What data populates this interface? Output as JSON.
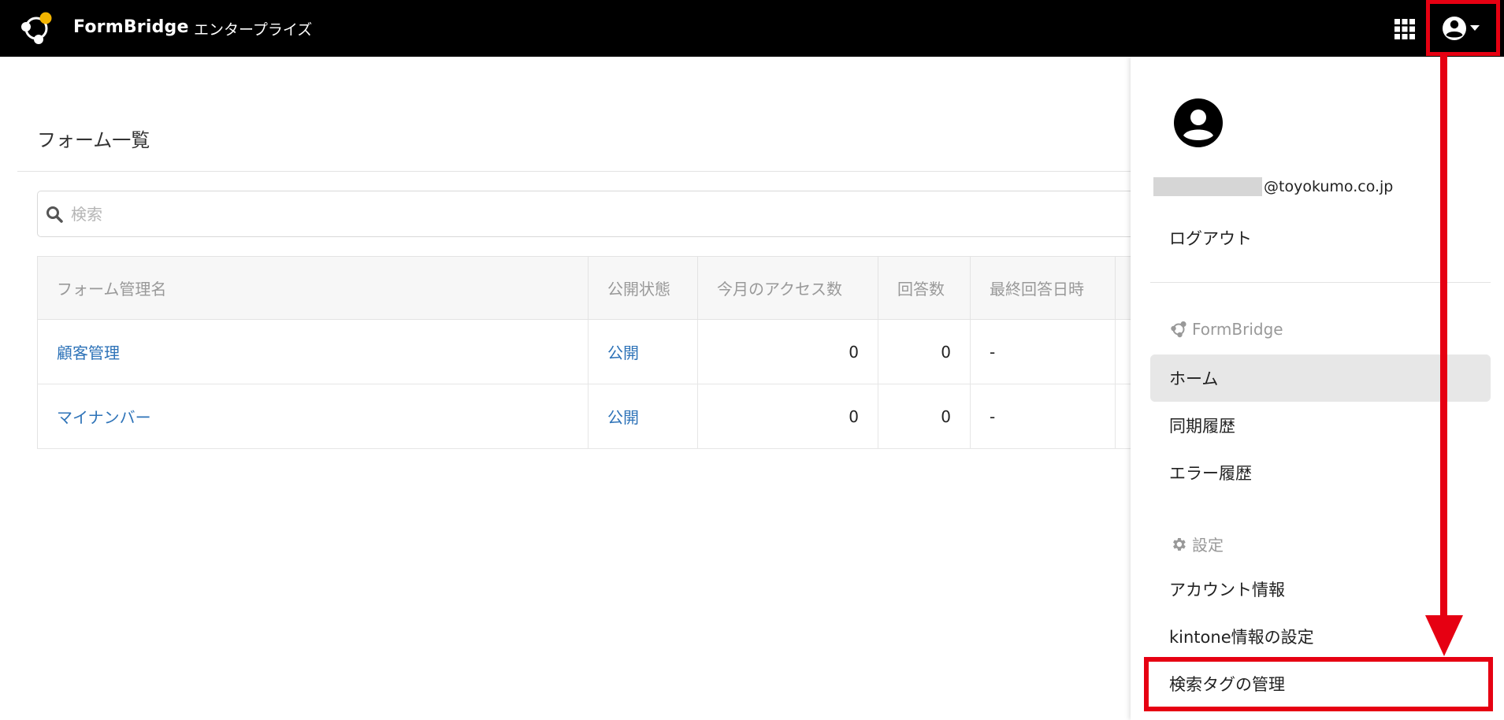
{
  "header": {
    "brand": "FormBridge",
    "plan": "エンタープライズ"
  },
  "main": {
    "title": "フォーム一覧",
    "search": {
      "placeholder": "検索",
      "value": ""
    },
    "table": {
      "columns": [
        "フォーム管理名",
        "公開状態",
        "今月のアクセス数",
        "回答数",
        "最終回答日時"
      ],
      "rows": [
        {
          "name": "顧客管理",
          "status": "公開",
          "access": "0",
          "answers": "0",
          "last": "-"
        },
        {
          "name": "マイナンバー",
          "status": "公開",
          "access": "0",
          "answers": "0",
          "last": "-"
        }
      ]
    }
  },
  "menu": {
    "email_suffix": "@toyokumo.co.jp",
    "logout": "ログアウト",
    "formbridge_section": "FormBridge",
    "home": "ホーム",
    "sync_history": "同期履歴",
    "error_history": "エラー履歴",
    "settings_section": "設定",
    "account_info": "アカウント情報",
    "kintone_settings": "kintone情報の設定",
    "search_tags": "検索タグの管理"
  },
  "colors": {
    "header_bg": "#000000",
    "link": "#2e73b8",
    "annotation_red": "#e60012",
    "logo_accent": "#f2b400"
  }
}
